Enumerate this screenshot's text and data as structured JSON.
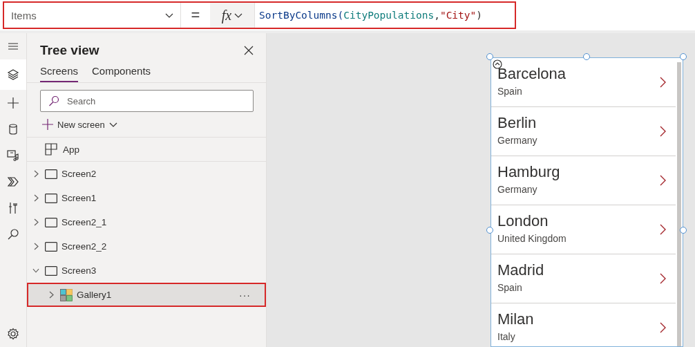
{
  "formula_bar": {
    "property": "Items",
    "operator": "=",
    "fx_label": "fx",
    "highlighted": true,
    "formula": "SortByColumns(CityPopulations,\"City\")"
  },
  "rail": [
    {
      "kind": "menu",
      "selected": false
    },
    {
      "kind": "layers",
      "selected": true
    },
    {
      "kind": "plus",
      "selected": false
    },
    {
      "kind": "data",
      "selected": false
    },
    {
      "kind": "media",
      "selected": false
    },
    {
      "kind": "flow",
      "selected": false
    },
    {
      "kind": "tools",
      "selected": false
    },
    {
      "kind": "search",
      "selected": false
    },
    {
      "kind": "settings",
      "selected": false
    }
  ],
  "tree_view": {
    "title": "Tree view",
    "tabs": [
      {
        "label": "Screens",
        "selected": true
      },
      {
        "label": "Components",
        "selected": false
      }
    ],
    "search": {
      "placeholder": "Search"
    },
    "new_screen": "New screen",
    "app": "App",
    "items": [
      {
        "label": "Screen2",
        "kind": "screen",
        "expanded": false,
        "selected": false
      },
      {
        "label": "Screen1",
        "kind": "screen",
        "expanded": false,
        "selected": false
      },
      {
        "label": "Screen2_1",
        "kind": "screen",
        "expanded": false,
        "selected": false
      },
      {
        "label": "Screen2_2",
        "kind": "screen",
        "expanded": false,
        "selected": false
      },
      {
        "label": "Screen3",
        "kind": "screen",
        "expanded": true,
        "selected": false,
        "children": [
          {
            "label": "Gallery1",
            "kind": "gallery",
            "expanded": false,
            "selected": true,
            "more": "···"
          }
        ]
      }
    ]
  },
  "gallery": {
    "items": [
      {
        "title": "Barcelona",
        "subtitle": "Spain"
      },
      {
        "title": "Berlin",
        "subtitle": "Germany"
      },
      {
        "title": "Hamburg",
        "subtitle": "Germany"
      },
      {
        "title": "London",
        "subtitle": "United Kingdom"
      },
      {
        "title": "Madrid",
        "subtitle": "Spain"
      },
      {
        "title": "Milan",
        "subtitle": "Italy"
      }
    ]
  }
}
